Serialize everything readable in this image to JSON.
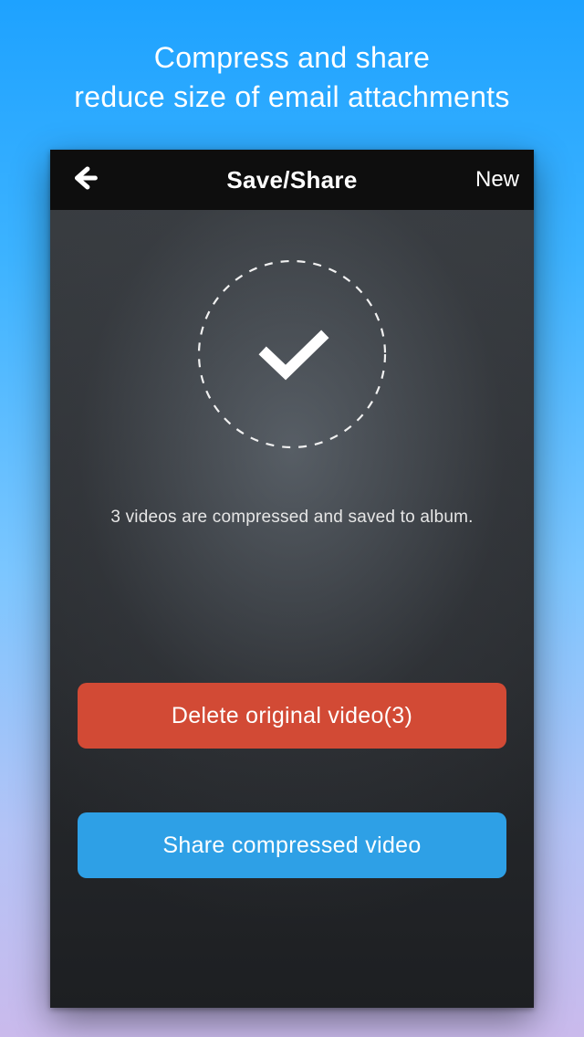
{
  "promo": {
    "line1": "Compress and share",
    "line2": "reduce size of email attachments"
  },
  "nav": {
    "title": "Save/Share",
    "new": "New"
  },
  "status": {
    "message": "3 videos are compressed and saved to album."
  },
  "buttons": {
    "delete": "Delete original video(3)",
    "share": "Share compressed video"
  }
}
